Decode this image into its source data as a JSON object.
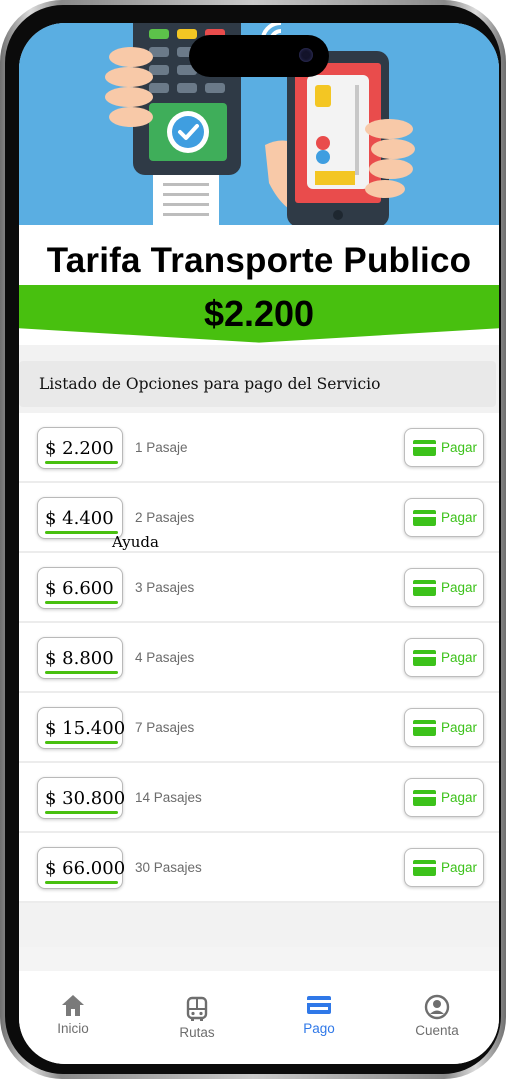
{
  "header": {
    "title": "Tarifa Transporte Publico",
    "price": "$2.200"
  },
  "section_title": "Listado de Opciones para pago del Servicio",
  "options": [
    {
      "amount": "$  2.200",
      "label": "1 Pasaje",
      "pay_label": "Pagar"
    },
    {
      "amount": "$  4.400",
      "label": "2 Pasajes",
      "pay_label": "Pagar"
    },
    {
      "amount": "$  6.600",
      "label": "3 Pasajes",
      "pay_label": "Pagar"
    },
    {
      "amount": "$  8.800",
      "label": "4 Pasajes",
      "pay_label": "Pagar"
    },
    {
      "amount": "$ 15.400",
      "label": "7 Pasajes",
      "pay_label": "Pagar"
    },
    {
      "amount": "$ 30.800",
      "label": "14 Pasajes",
      "pay_label": "Pagar"
    },
    {
      "amount": "$ 66.000",
      "label": "30 Pasajes",
      "pay_label": "Pagar"
    }
  ],
  "help_text": "Ayuda",
  "tabs": [
    {
      "label": "Inicio",
      "icon": "home-icon"
    },
    {
      "label": "Rutas",
      "icon": "bus-icon"
    },
    {
      "label": "Pago",
      "icon": "card-icon",
      "active": true
    },
    {
      "label": "Cuenta",
      "icon": "account-icon"
    }
  ],
  "colors": {
    "accent_green": "#48c00f",
    "active_tab": "#2f78e8",
    "hero_bg": "#5aaee2"
  }
}
